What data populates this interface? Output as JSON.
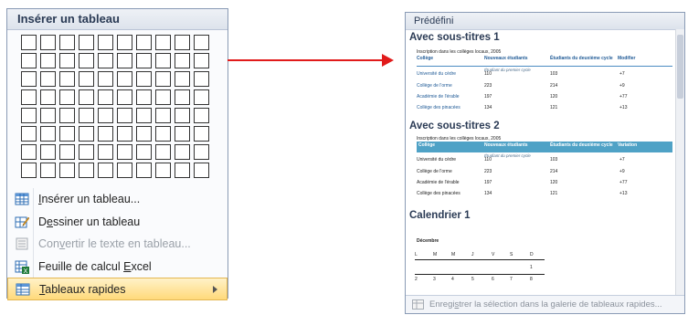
{
  "left_menu": {
    "title": "Insérer un tableau",
    "grid": {
      "cols": 10,
      "rows": 8
    },
    "items": [
      {
        "pre": "",
        "u": "I",
        "post": "nsérer un tableau...",
        "icon": "table-icon",
        "disabled": false,
        "highlight": false,
        "submenu": false
      },
      {
        "pre": "D",
        "u": "e",
        "post": "ssiner un tableau",
        "icon": "pencil-icon",
        "disabled": false,
        "highlight": false,
        "submenu": false
      },
      {
        "pre": "Con",
        "u": "v",
        "post": "ertir le texte en tableau...",
        "icon": "convert-icon",
        "disabled": true,
        "highlight": false,
        "submenu": false
      },
      {
        "pre": "Feuille de calcul ",
        "u": "E",
        "post": "xcel",
        "icon": "excel-icon",
        "disabled": false,
        "highlight": false,
        "submenu": false
      },
      {
        "pre": "",
        "u": "T",
        "post": "ableaux rapides",
        "icon": "quick-table-icon",
        "disabled": false,
        "highlight": true,
        "submenu": true
      }
    ]
  },
  "right_panel": {
    "title": "Prédéfini",
    "section1": {
      "heading": "Avec sous-titres 1",
      "caption": "Inscription dans les collèges locaux, 2005",
      "headers": [
        "Collège",
        "Nouveaux étudiants",
        "Étudiants du deuxième cycle",
        "Modifier"
      ],
      "subheader": "Étudiant du premier cycle",
      "rows": [
        [
          "Université du cèdre",
          "110",
          "103",
          "+7"
        ],
        [
          "Collège de l'orme",
          "223",
          "214",
          "+9"
        ],
        [
          "Académie de l'érable",
          "197",
          "120",
          "+77"
        ],
        [
          "Collège des pinacées",
          "134",
          "121",
          "+13"
        ]
      ]
    },
    "section2": {
      "heading": "Avec sous-titres 2",
      "caption": "Inscription dans les collèges locaux, 2005",
      "headers": [
        "Collège",
        "Nouveaux étudiants",
        "Étudiants du deuxième cycle",
        "Variation"
      ],
      "subheader": "Étudiant du premier cycle",
      "rows": [
        [
          "Université du cèdre",
          "110",
          "103",
          "+7"
        ],
        [
          "Collège de l'orme",
          "223",
          "214",
          "+9"
        ],
        [
          "Académie de l'érable",
          "197",
          "120",
          "+77"
        ],
        [
          "Collège des pinacées",
          "134",
          "121",
          "+13"
        ]
      ]
    },
    "section3": {
      "heading": "Calendrier 1",
      "month": "Décembre",
      "days": [
        "L",
        "M",
        "M",
        "J",
        "V",
        "S",
        "D"
      ],
      "first": "1",
      "dates": [
        "2",
        "3",
        "4",
        "5",
        "6",
        "7",
        "8"
      ]
    },
    "footer": {
      "pre": "Enregi",
      "u": "s",
      "post": "trer la sélection dans la galerie de tableaux rapides..."
    }
  },
  "colors": {
    "arrow": "#e11b1b",
    "highlight": "#ffd97a",
    "table_header_fill": "#4fa2c6",
    "table_text_blue": "#1f5a96"
  }
}
